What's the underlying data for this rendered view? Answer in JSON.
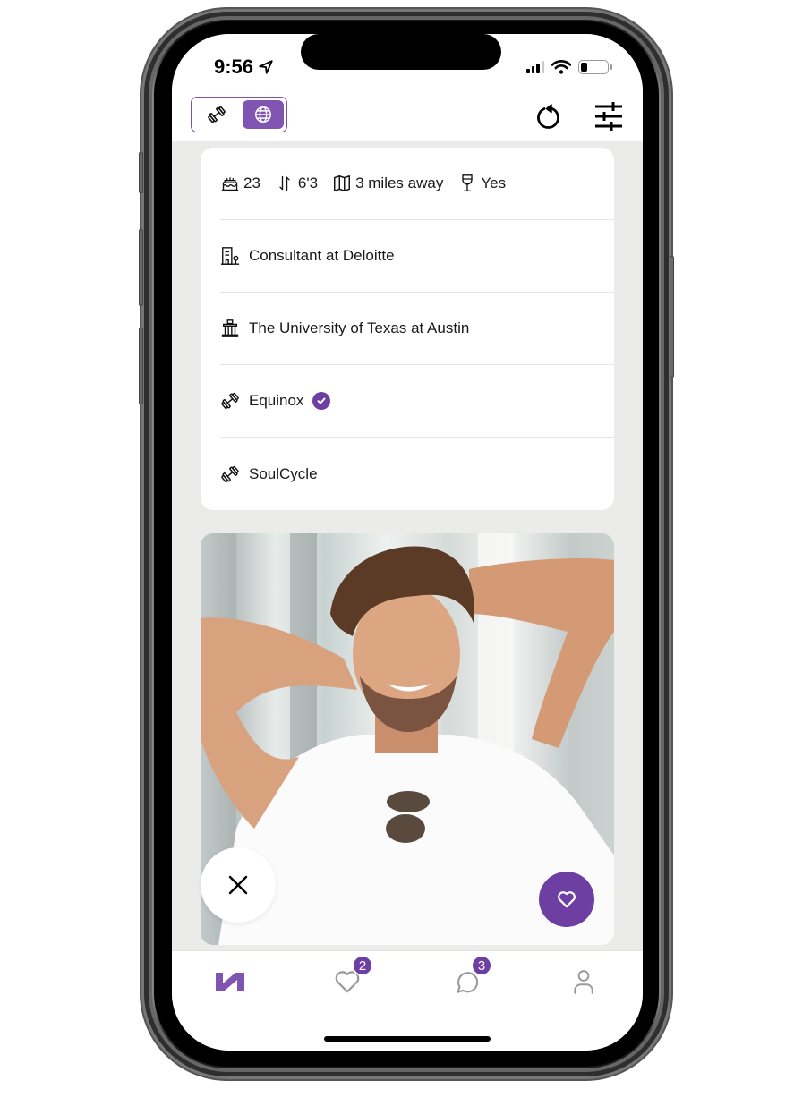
{
  "status_bar": {
    "time": "9:56",
    "location_icon": "location-arrow-icon",
    "signal_icon": "cellular-signal-icon",
    "wifi_icon": "wifi-icon",
    "battery_icon": "battery-icon",
    "battery_level": 0.2
  },
  "header": {
    "mode_toggle": {
      "options": [
        {
          "name": "gym",
          "icon": "dumbbell-icon",
          "active": false
        },
        {
          "name": "global",
          "icon": "globe-icon",
          "active": true
        }
      ]
    },
    "undo_icon": "undo-icon",
    "filters_icon": "sliders-icon"
  },
  "profile": {
    "stats": [
      {
        "icon": "birthday-cake-icon",
        "value": "23"
      },
      {
        "icon": "height-icon",
        "value": "6'3"
      },
      {
        "icon": "map-icon",
        "value": "3 miles away"
      },
      {
        "icon": "wine-glass-icon",
        "value": "Yes"
      }
    ],
    "job": {
      "icon": "office-building-icon",
      "value": "Consultant at Deloitte"
    },
    "school": {
      "icon": "university-icon",
      "value": "The University of Texas at Austin"
    },
    "gyms": [
      {
        "icon": "dumbbell-icon",
        "value": "Equinox",
        "verified": true
      },
      {
        "icon": "dumbbell-icon",
        "value": "SoulCycle",
        "verified": false
      }
    ]
  },
  "photo": {
    "alt": "Smiling man in white t-shirt with hands behind head"
  },
  "actions": {
    "pass_icon": "close-icon",
    "like_icon": "heart-icon"
  },
  "tabbar": {
    "tabs": [
      {
        "name": "home",
        "icon": "app-logo-icon",
        "active": true
      },
      {
        "name": "likes",
        "icon": "heart-icon",
        "badge": "2"
      },
      {
        "name": "messages",
        "icon": "chat-bubble-icon",
        "badge": "3"
      },
      {
        "name": "profile",
        "icon": "person-icon"
      }
    ]
  },
  "colors": {
    "accent": "#6e3fa3",
    "accent_light": "#7f55b1",
    "background": "#ebebea",
    "text": "#1a1a1a"
  }
}
